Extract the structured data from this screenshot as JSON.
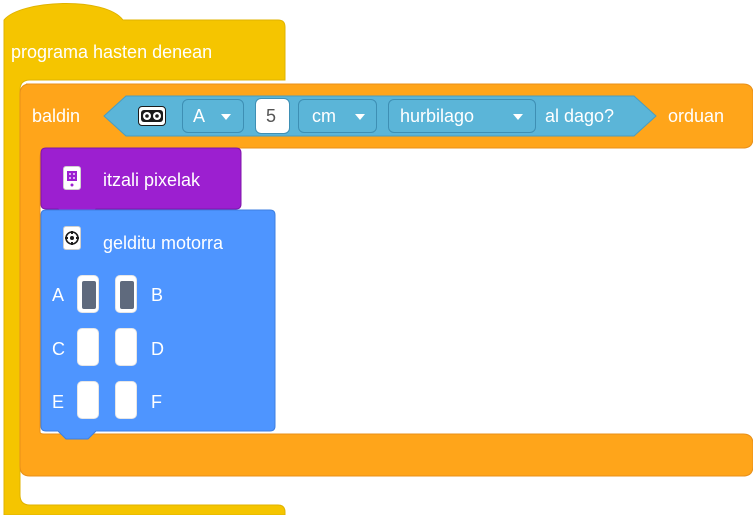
{
  "colors": {
    "event_yellow": "#F5C500",
    "control_orange": "#FFA51A",
    "sensor_teal": "#5BB5D8",
    "display_purple": "#9C1FD0",
    "motor_blue": "#4E95FF",
    "port_active": "#5F6A7D"
  },
  "hat_block": {
    "label": "programa hasten denean"
  },
  "if_block": {
    "label": "baldin",
    "then_label": "orduan"
  },
  "condition": {
    "sensor_icon": "distance-sensor-icon",
    "port": "A",
    "value": "5",
    "unit": "cm",
    "comparison": "hurbilago",
    "suffix": "al dago?"
  },
  "display_block": {
    "icon": "light-matrix-icon",
    "label": "itzali pixelak"
  },
  "motor_block": {
    "icon": "motor-icon",
    "label": "gelditu motorra",
    "ports": [
      {
        "left": "A",
        "right": "B",
        "left_on": true,
        "right_on": true
      },
      {
        "left": "C",
        "right": "D",
        "left_on": false,
        "right_on": false
      },
      {
        "left": "E",
        "right": "F",
        "left_on": false,
        "right_on": false
      }
    ]
  }
}
